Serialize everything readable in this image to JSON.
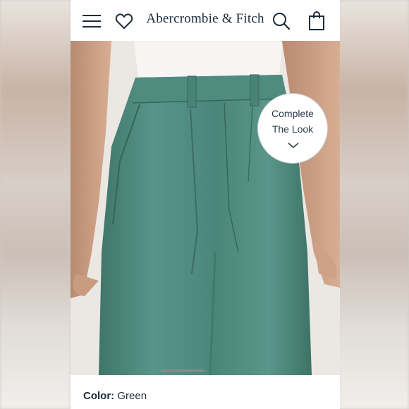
{
  "header": {
    "brand_name": "Abercrombie & Fitch",
    "icons": {
      "menu": "hamburger-menu-icon",
      "wishlist": "heart-icon",
      "search": "search-icon",
      "bag": "shopping-bag-icon"
    }
  },
  "complete_the_look": {
    "line1": "Complete",
    "line2": "The Look",
    "icon": "chevron-down-icon"
  },
  "product": {
    "color_label": "Color:",
    "color_value": "Green",
    "garment_color": "#4e8a7c"
  },
  "carousel": {
    "indicator": "active-slide-indicator"
  }
}
